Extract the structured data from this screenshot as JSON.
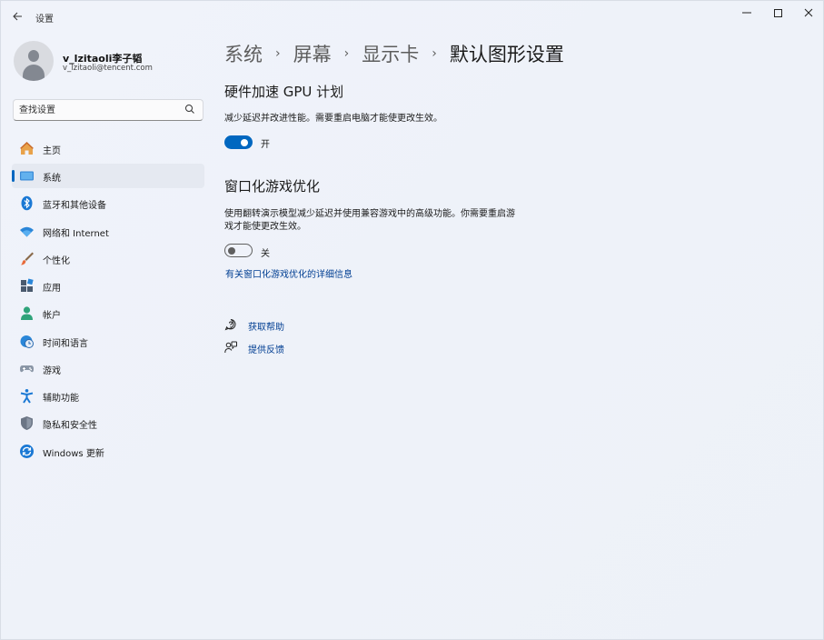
{
  "window": {
    "title": "设置",
    "controls": {
      "minimize": "—",
      "maximize": "",
      "close": "✕"
    }
  },
  "profile": {
    "name": "v_lzitaoli李子韬",
    "email": "v_lzitaoli@tencent.com"
  },
  "search": {
    "placeholder": "查找设置"
  },
  "sidebar": {
    "items": [
      {
        "label": "主页",
        "icon": "home-icon"
      },
      {
        "label": "系统",
        "icon": "system-icon",
        "selected": true
      },
      {
        "label": "蓝牙和其他设备",
        "icon": "bluetooth-icon"
      },
      {
        "label": "网络和 Internet",
        "icon": "wifi-icon"
      },
      {
        "label": "个性化",
        "icon": "brush-icon"
      },
      {
        "label": "应用",
        "icon": "apps-icon"
      },
      {
        "label": "帐户",
        "icon": "account-icon"
      },
      {
        "label": "时间和语言",
        "icon": "globe-clock-icon"
      },
      {
        "label": "游戏",
        "icon": "gamepad-icon"
      },
      {
        "label": "辅助功能",
        "icon": "accessibility-icon"
      },
      {
        "label": "隐私和安全性",
        "icon": "shield-icon"
      },
      {
        "label": "Windows 更新",
        "icon": "update-icon"
      }
    ]
  },
  "breadcrumb": {
    "items": [
      "系统",
      "屏幕",
      "显示卡"
    ],
    "current": "默认图形设置"
  },
  "gpu_scheduling": {
    "title": "硬件加速 GPU 计划",
    "description": "减少延迟并改进性能。需要重启电脑才能使更改生效。",
    "toggle_state": true,
    "toggle_label": "开"
  },
  "windowed_games": {
    "title": "窗口化游戏优化",
    "description_line1": "使用翻转演示模型减少延迟并使用兼容游戏中的高级功能。你需要重启游",
    "description_line2": "戏才能使更改生效。",
    "toggle_state": false,
    "toggle_label": "关",
    "more_info_link": "有关窗口化游戏优化的详细信息"
  },
  "help": {
    "get_help": "获取帮助",
    "feedback": "提供反馈"
  },
  "colors": {
    "accent": "#0067c0",
    "link": "#003e92",
    "background": "#eef2f9"
  }
}
